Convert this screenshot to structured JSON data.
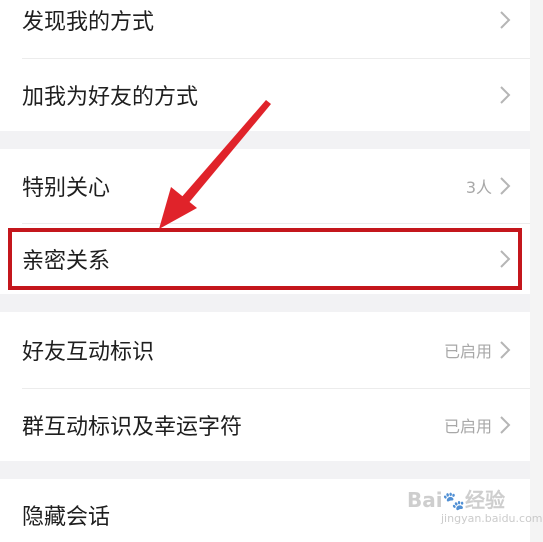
{
  "settings": {
    "items": [
      {
        "label": "发现我的方式",
        "value": ""
      },
      {
        "label": "加我为好友的方式",
        "value": ""
      },
      {
        "label": "特别关心",
        "value": "3人"
      },
      {
        "label": "亲密关系",
        "value": ""
      },
      {
        "label": "好友互动标识",
        "value": "已启用"
      },
      {
        "label": "群互动标识及幸运字符",
        "value": "已启用"
      },
      {
        "label": "隐藏会话",
        "value": ""
      }
    ]
  },
  "annotation": {
    "highlight_color": "#c4161c",
    "arrow_color": "#e0232a",
    "highlighted_item": "亲密关系"
  },
  "watermark": {
    "line1": "Bai",
    "line1_b": "经验",
    "line2": "jingyan.baidu.com"
  },
  "colors": {
    "separator": "#f2f2f4",
    "text": "#1f1f1f",
    "secondary_text": "#a8a8a8",
    "chevron": "#b5b5b5"
  }
}
